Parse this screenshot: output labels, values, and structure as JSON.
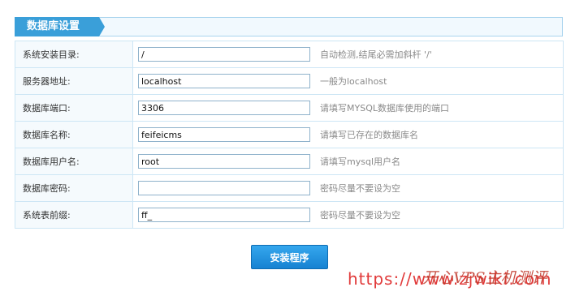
{
  "panel": {
    "title": "数据库设置"
  },
  "fields": [
    {
      "label": "系统安装目录:",
      "value": "/",
      "hint": "自动检测,结尾必需加斜杆 '/'"
    },
    {
      "label": "服务器地址:",
      "value": "localhost",
      "hint": "一般为localhost"
    },
    {
      "label": "数据库端口:",
      "value": "3306",
      "hint": "请填写MYSQL数据库使用的端口"
    },
    {
      "label": "数据库名称:",
      "value": "feifeicms",
      "hint": "请填写已存在的数据库名"
    },
    {
      "label": "数据库用户名:",
      "value": "root",
      "hint": "请填写mysql用户名"
    },
    {
      "label": "数据库密码:",
      "value": "",
      "hint": "密码尽量不要设为空"
    },
    {
      "label": "系统表前缀:",
      "value": "ff_",
      "hint": "密码尽量不要设为空"
    }
  ],
  "actions": {
    "install_label": "安装程序"
  },
  "watermark": {
    "text": "https://www.zjwiki.com",
    "overlay": "开心VPS主机测评"
  },
  "colors": {
    "accent": "#3a9fd9",
    "border": "#cde6f5",
    "button": "#1682d2"
  }
}
